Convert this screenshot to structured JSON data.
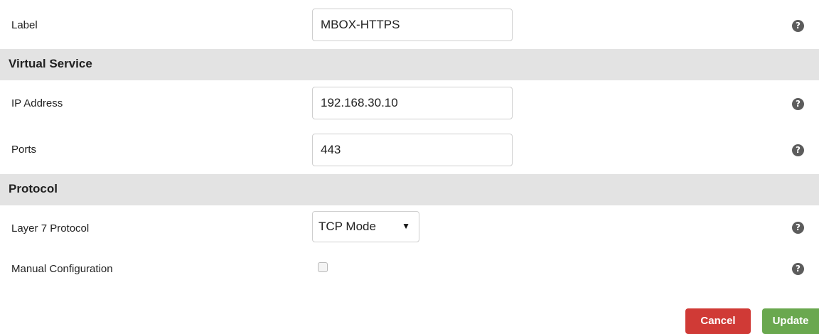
{
  "fields": {
    "label": {
      "label": "Label",
      "value": "MBOX-HTTPS"
    },
    "ip_address": {
      "label": "IP Address",
      "value": "192.168.30.10"
    },
    "ports": {
      "label": "Ports",
      "value": "443"
    },
    "layer7_protocol": {
      "label": "Layer 7 Protocol",
      "selected": "TCP Mode",
      "arrow": "▼"
    },
    "manual_configuration": {
      "label": "Manual Configuration",
      "checked": false
    }
  },
  "sections": {
    "virtual_service": "Virtual Service",
    "protocol": "Protocol"
  },
  "help": {
    "glyph": "?"
  },
  "buttons": {
    "cancel": "Cancel",
    "update": "Update"
  },
  "colors": {
    "section_bg": "#e3e3e3",
    "cancel": "#d03a36",
    "update": "#6aa84f",
    "help_icon": "#5c5c5c"
  }
}
